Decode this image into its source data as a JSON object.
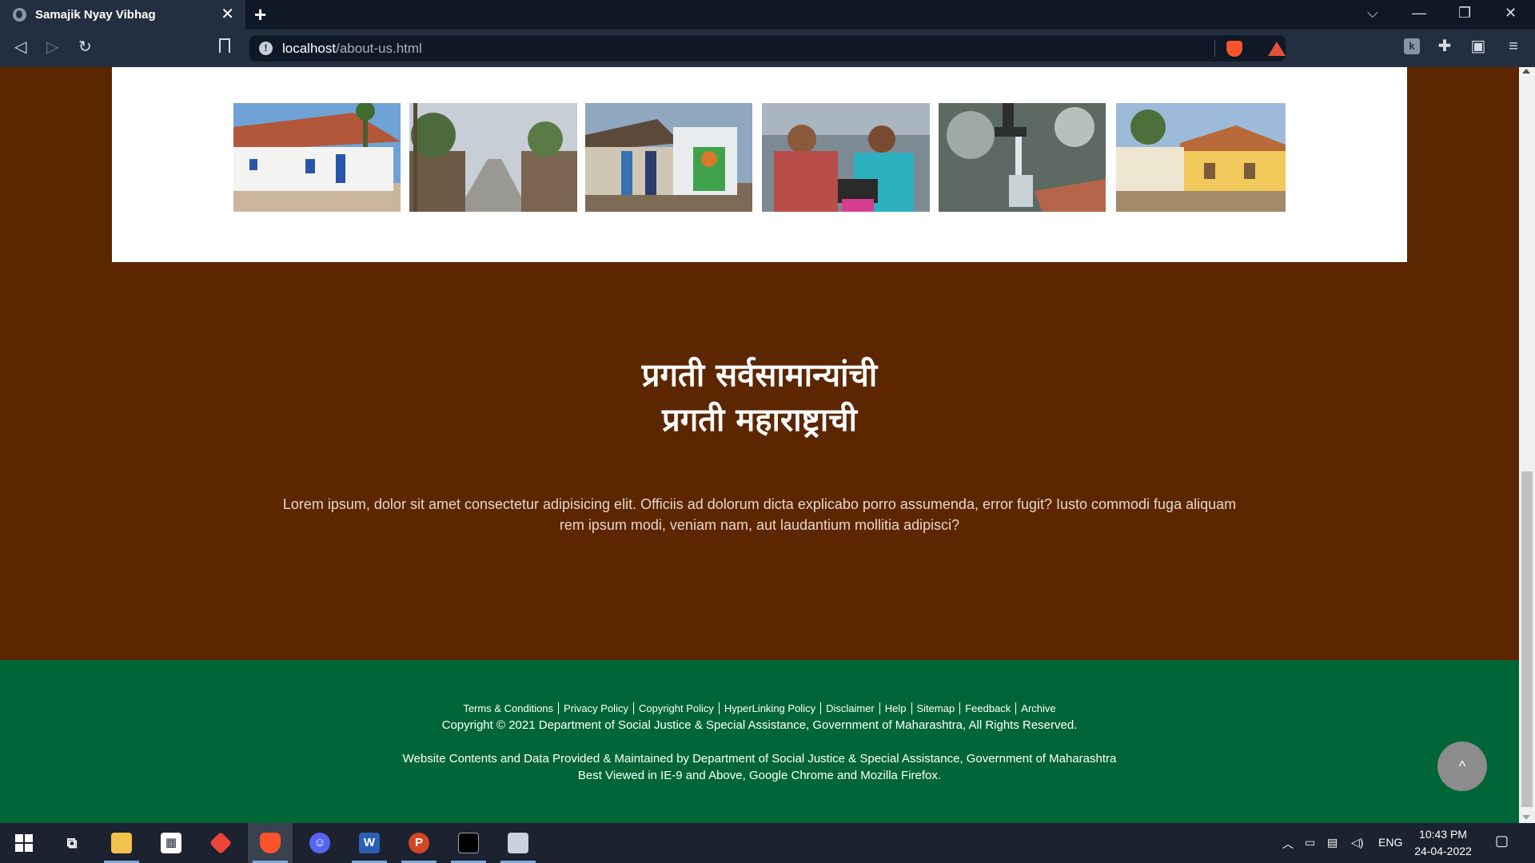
{
  "browser": {
    "tab_title": "Samajik Nyay Vibhag",
    "tab_close": "✕",
    "new_tab": "+",
    "url_host": "localhost",
    "url_path": "/about-us.html",
    "window_controls": [
      "⌵",
      "—",
      "❐",
      "✕"
    ],
    "icons": [
      "back-icon",
      "forward-icon",
      "reload-icon",
      "bookmark-icon",
      "site-info-icon",
      "brave-shields-icon",
      "brave-rewards-icon",
      "extension-k-icon",
      "extensions-puzzle-icon",
      "wallet-icon",
      "menu-icon"
    ]
  },
  "page": {
    "gallery": [
      {
        "name": "white-house-photo"
      },
      {
        "name": "village-street-photo"
      },
      {
        "name": "toilet-mural-photo"
      },
      {
        "name": "women-laptop-photo"
      },
      {
        "name": "water-tap-photo"
      },
      {
        "name": "yellow-house-photo"
      }
    ],
    "tagline_line1": "प्रगती सर्वसामान्यांची",
    "tagline_line2": "प्रगती महाराष्ट्राची",
    "lorem": "Lorem ipsum, dolor sit amet consectetur adipisicing elit. Officiis ad dolorum dicta explicabo porro assumenda, error fugit? Iusto commodi fuga aliquam rem ipsum modi, veniam nam, aut laudantium mollitia adipisci?",
    "back_to_top": "^"
  },
  "footer": {
    "links": [
      "Terms & Conditions",
      "Privacy Policy",
      "Copyright Policy",
      "HyperLinking Policy",
      "Disclaimer",
      "Help",
      "Sitemap",
      "Feedback",
      "Archive"
    ],
    "copyright": "Copyright © 2021 Department of Social Justice & Special Assistance, Government of Maharashtra, All Rights Reserved.",
    "maintained": "Website Contents and Data Provided & Maintained by Department of Social Justice & Special Assistance, Government of Maharashtra",
    "best_viewed": "Best Viewed in IE-9 and Above, Google Chrome and Mozilla Firefox."
  },
  "taskbar": {
    "apps": [
      "start",
      "task-view",
      "file-explorer",
      "microsoft-store",
      "anydesk",
      "brave",
      "discord",
      "word",
      "powerpoint",
      "terminal",
      "snipping-tool"
    ],
    "tray_lang": "ENG",
    "time": "10:43 PM",
    "date": "24-04-2022"
  },
  "colors": {
    "page_bg": "#5c2600",
    "footer_bg": "#006637",
    "panel_bg": "#ffffff"
  }
}
